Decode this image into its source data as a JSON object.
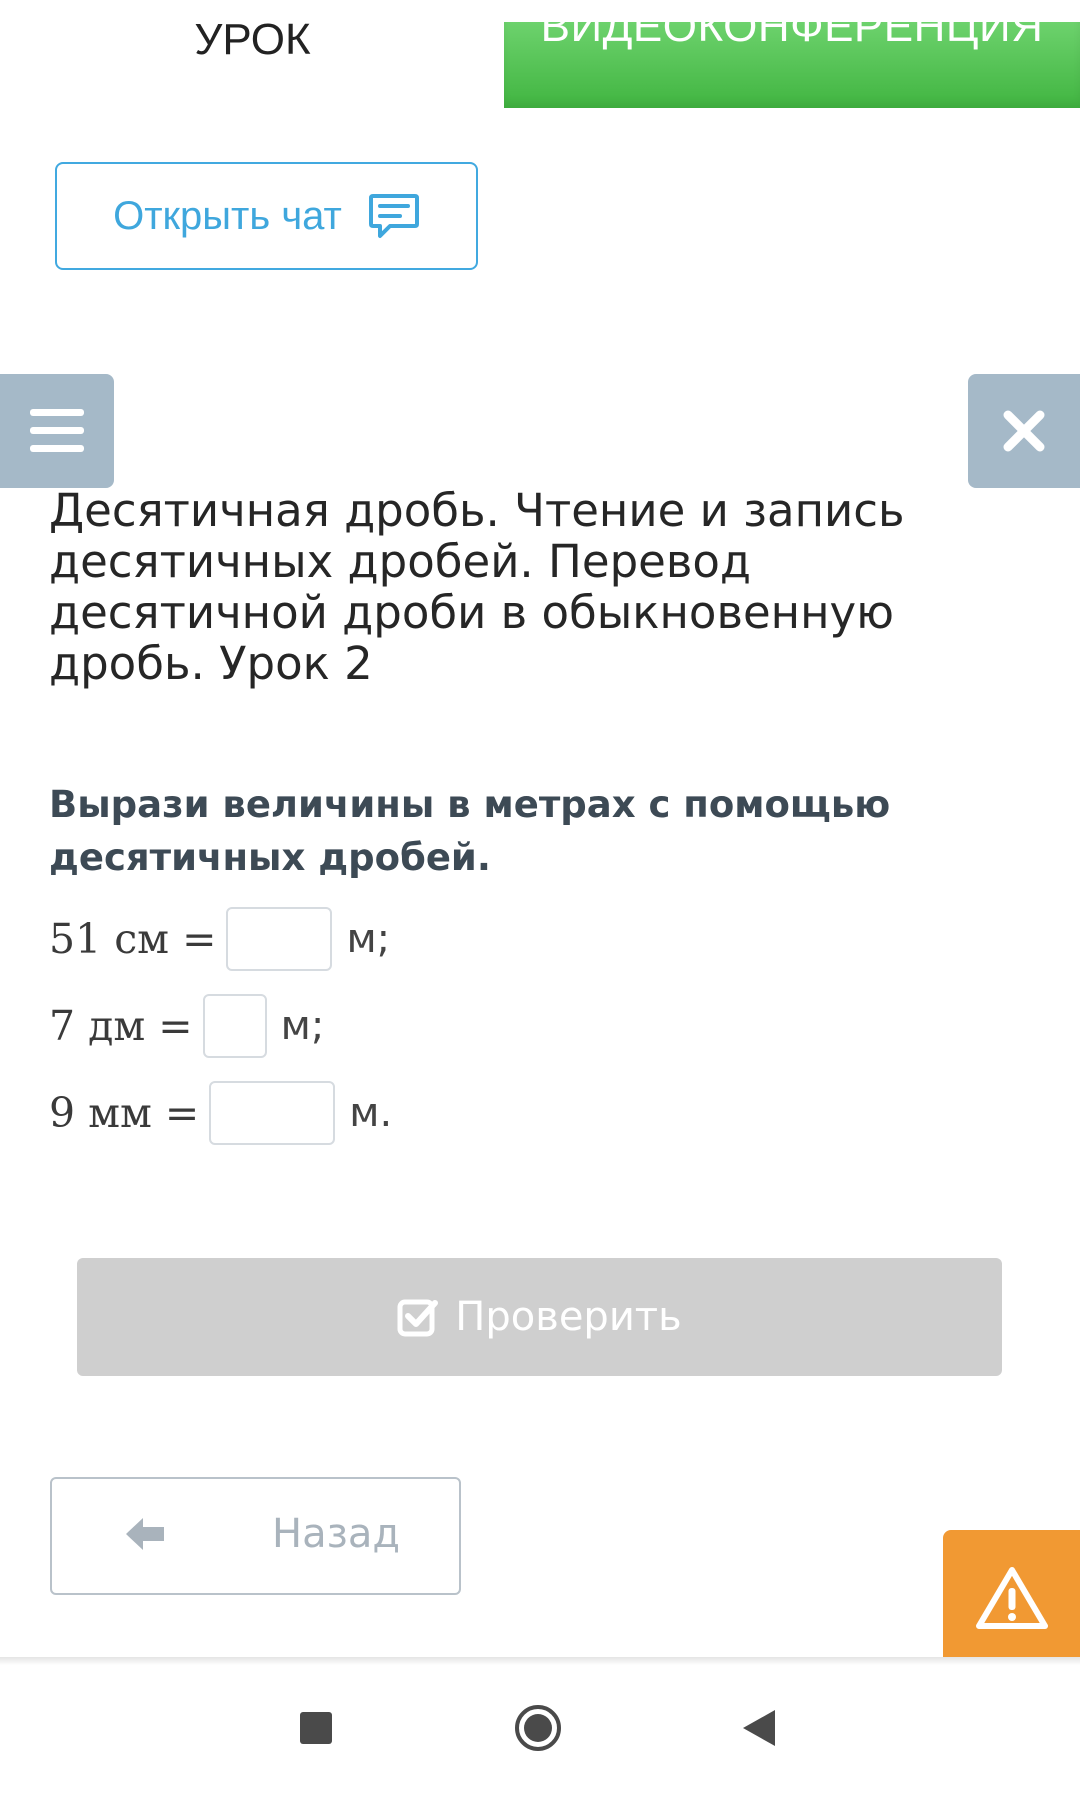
{
  "tabs": {
    "lesson": "УРОК",
    "video": "ВИДЕОКОНФЕРЕНЦИЯ"
  },
  "chat": {
    "label": "Открыть чат",
    "icon": "chat-icon"
  },
  "toolbar": {
    "menu_icon": "hamburger-icon",
    "close_icon": "close-icon"
  },
  "lesson": {
    "title": "Десятичная дробь. Чтение и запись десятичных дробей. Перевод десятичной дроби в обыкновенную дробь. Урок 2"
  },
  "task": {
    "title": "Вырази величины в метрах с помощью десятичных дробей.",
    "rows": [
      {
        "lhs": "51 см =",
        "value": "",
        "unit": "м;"
      },
      {
        "lhs": "7 дм =",
        "value": "",
        "unit": "м;"
      },
      {
        "lhs": "9 мм =",
        "value": "",
        "unit": "м."
      }
    ]
  },
  "check": {
    "label": "Проверить",
    "icon": "checkbox-icon"
  },
  "back": {
    "label": "Назад",
    "icon": "arrow-left-icon"
  },
  "warning": {
    "icon": "warning-icon"
  },
  "colors": {
    "green": "#41b541",
    "blue": "#3fa7dd",
    "gray_button": "#cfcfcf",
    "slate": "#a5b9c8",
    "orange": "#f19933"
  }
}
